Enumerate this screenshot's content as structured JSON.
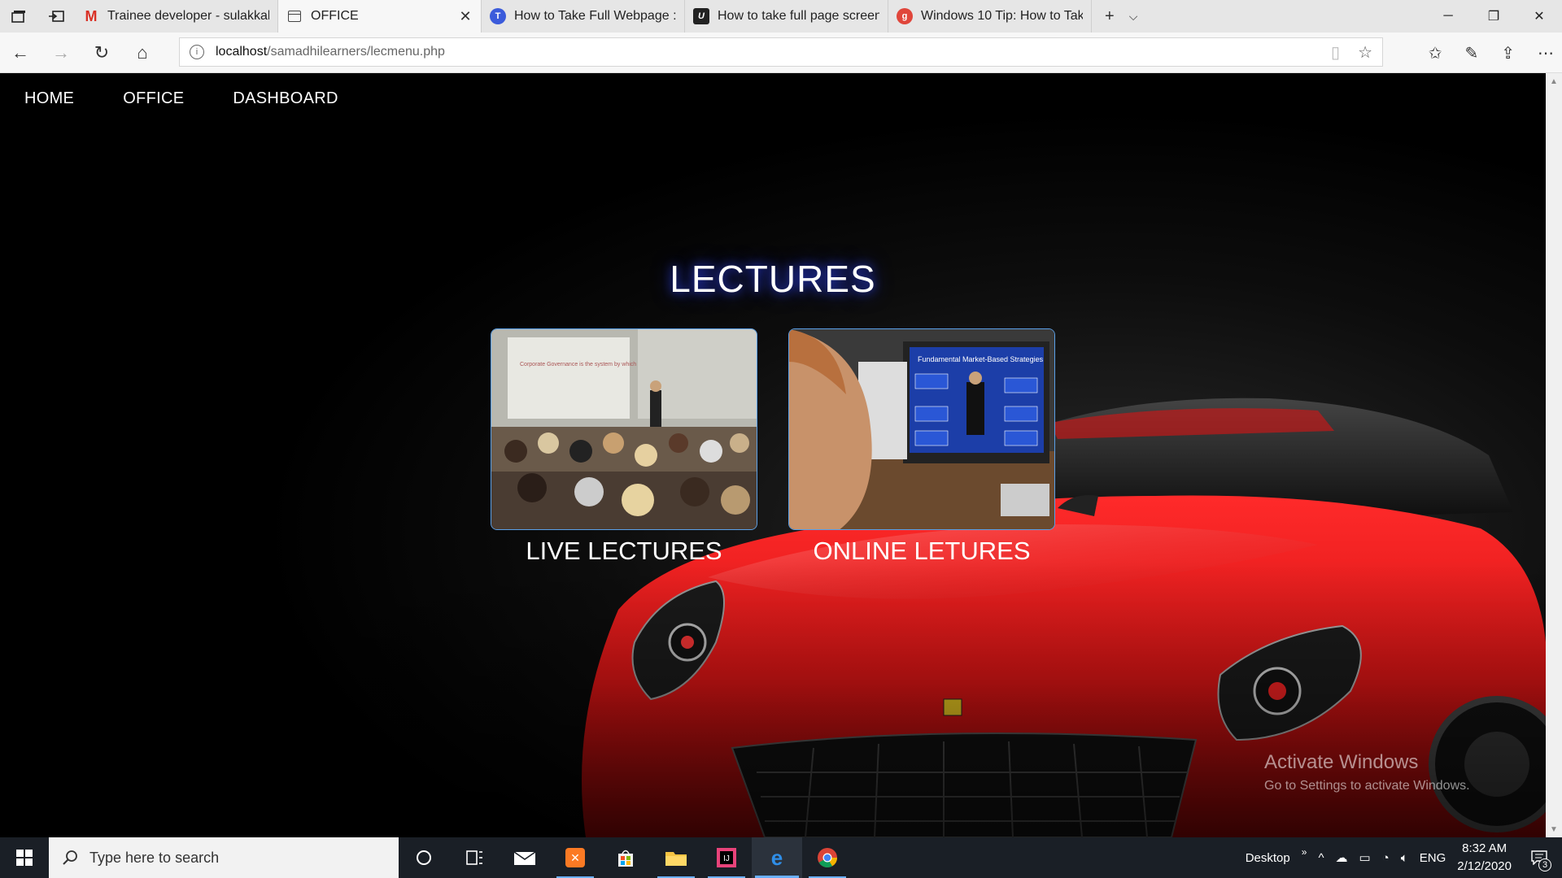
{
  "browser": {
    "tabs": [
      {
        "title": "Trainee developer - sulakkal",
        "icon": "gmail-icon",
        "active": false
      },
      {
        "title": "OFFICE",
        "icon": "page-icon",
        "active": true
      },
      {
        "title": "How to Take Full Webpage :",
        "icon": "techtalk-icon",
        "active": false
      },
      {
        "title": "How to take full page screen",
        "icon": "udemy-icon",
        "active": false
      },
      {
        "title": "Windows 10 Tip: How to Tak",
        "icon": "g-icon",
        "active": false
      }
    ],
    "address": {
      "host": "localhost",
      "path": "/samadhilearners/lecmenu.php"
    }
  },
  "page": {
    "nav": [
      "HOME",
      "OFFICE",
      "DASHBOARD"
    ],
    "heading": "LECTURES",
    "cards": [
      {
        "caption": "LIVE LECTURES",
        "slide_text": "Corporate Governance is the system by which companies are directed and controlled"
      },
      {
        "caption": "ONLINE LETURES",
        "slide_text": "Fundamental Market-Based Strategies"
      }
    ],
    "watermark": {
      "line1": "Activate Windows",
      "line2": "Go to Settings to activate Windows."
    },
    "colors": {
      "car_red": "#d81414",
      "heading_glow": "#2b3bd6",
      "card_border": "#5aa0e8"
    }
  },
  "taskbar": {
    "search_placeholder": "Type here to search",
    "desktop_label": "Desktop",
    "language": "ENG",
    "time": "8:32 AM",
    "date": "2/12/2020",
    "notification_count": "3"
  }
}
